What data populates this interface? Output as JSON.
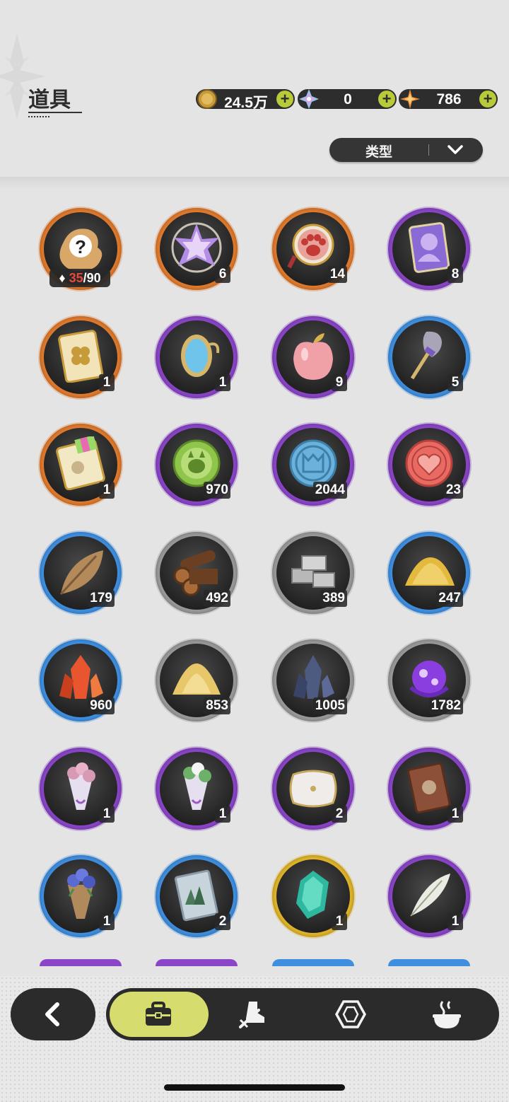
{
  "header": {
    "title": "道具",
    "currencies": [
      {
        "icon": "gold-coin-icon",
        "value": "24.5万"
      },
      {
        "icon": "crystal-icon",
        "value": "0"
      },
      {
        "icon": "star-gem-icon",
        "value": "786"
      }
    ],
    "plus_label": "+"
  },
  "filter": {
    "label": "类型"
  },
  "items": [
    {
      "icon": "mystery-puzzle-icon",
      "rarity": "orange",
      "limit_current": "35",
      "limit_max": "/90"
    },
    {
      "icon": "star-crystal-icon",
      "rarity": "orange",
      "count": "6"
    },
    {
      "icon": "paw-badge-icon",
      "rarity": "orange",
      "count": "14"
    },
    {
      "icon": "portrait-card-icon",
      "rarity": "purple",
      "count": "8"
    },
    {
      "icon": "clover-ticket-icon",
      "rarity": "orange",
      "count": "1"
    },
    {
      "icon": "magic-mirror-icon",
      "rarity": "purple",
      "count": "1"
    },
    {
      "icon": "pink-apple-icon",
      "rarity": "purple",
      "count": "9"
    },
    {
      "icon": "shovel-icon",
      "rarity": "blue",
      "count": "5"
    },
    {
      "icon": "rainbow-ticket-icon",
      "rarity": "orange",
      "count": "1"
    },
    {
      "icon": "green-cat-coin-icon",
      "rarity": "purple",
      "count": "970"
    },
    {
      "icon": "blue-crest-coin-icon",
      "rarity": "purple",
      "count": "2044"
    },
    {
      "icon": "heart-coin-icon",
      "rarity": "purple",
      "count": "23"
    },
    {
      "icon": "dry-leaf-icon",
      "rarity": "blue",
      "count": "179"
    },
    {
      "icon": "wood-logs-icon",
      "rarity": "gray",
      "count": "492"
    },
    {
      "icon": "stone-bricks-icon",
      "rarity": "gray",
      "count": "389"
    },
    {
      "icon": "gold-sand-icon",
      "rarity": "blue",
      "count": "247"
    },
    {
      "icon": "red-crystal-icon",
      "rarity": "blue",
      "count": "960"
    },
    {
      "icon": "sand-pile-icon",
      "rarity": "gray",
      "count": "853"
    },
    {
      "icon": "dark-crystal-icon",
      "rarity": "gray",
      "count": "1005"
    },
    {
      "icon": "purple-orb-icon",
      "rarity": "gray",
      "count": "1782"
    },
    {
      "icon": "pink-bouquet-icon",
      "rarity": "purple",
      "count": "1"
    },
    {
      "icon": "white-bouquet-icon",
      "rarity": "purple",
      "count": "1"
    },
    {
      "icon": "pillow-icon",
      "rarity": "purple",
      "count": "2"
    },
    {
      "icon": "book-icon",
      "rarity": "purple",
      "count": "1"
    },
    {
      "icon": "blue-bouquet-icon",
      "rarity": "blue",
      "count": "1"
    },
    {
      "icon": "forest-card-icon",
      "rarity": "blue",
      "count": "2"
    },
    {
      "icon": "teal-gem-icon",
      "rarity": "gold",
      "count": "1"
    },
    {
      "icon": "feather-icon",
      "rarity": "purple",
      "count": "1"
    }
  ],
  "rarity_colors": {
    "orange": "#e07a2e",
    "purple": "#8a45c8",
    "blue": "#3f8fe0",
    "gray": "#9a9a9a",
    "gold": "#e0b52a"
  },
  "nav": [
    {
      "icon": "back-arrow-icon"
    },
    {
      "icon": "bag-icon",
      "active": true
    },
    {
      "icon": "boot-sword-icon"
    },
    {
      "icon": "hexagon-gem-icon"
    },
    {
      "icon": "steaming-pot-icon"
    }
  ]
}
